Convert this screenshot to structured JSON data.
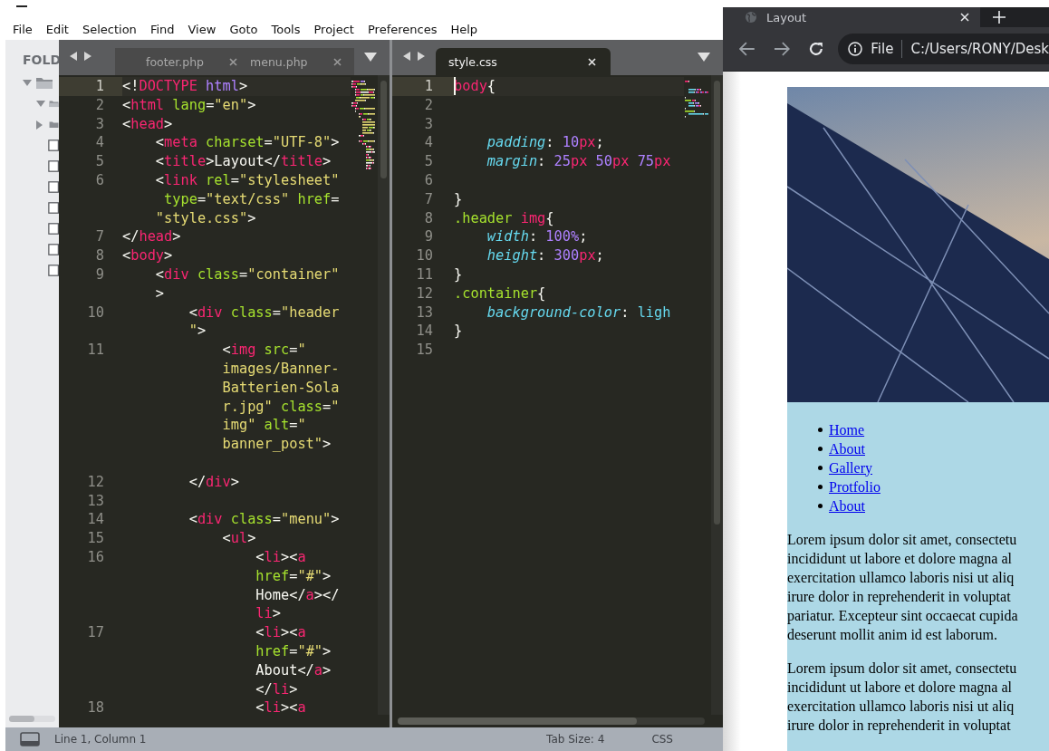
{
  "menu": [
    "File",
    "Edit",
    "Selection",
    "Find",
    "View",
    "Goto",
    "Tools",
    "Project",
    "Preferences",
    "Help"
  ],
  "sidebar": {
    "title": "FOLD",
    "items": [
      {
        "kind": "folder",
        "expanded": true,
        "children": [
          {
            "kind": "folder",
            "expanded": true
          },
          {
            "kind": "folder",
            "expanded": false
          },
          {
            "kind": "file"
          },
          {
            "kind": "file"
          },
          {
            "kind": "file"
          },
          {
            "kind": "file"
          },
          {
            "kind": "file"
          },
          {
            "kind": "file"
          },
          {
            "kind": "file"
          }
        ]
      }
    ]
  },
  "panes": [
    {
      "focused": false,
      "tabs": [
        {
          "label": "footer.php",
          "selected": false
        },
        {
          "label": "menu.php",
          "selected": false
        }
      ],
      "lines": [
        {
          "number": "1",
          "current": true,
          "rows": [
            {
              "segments": [
                {
                  "kind": "p",
                  "text": "<!"
                },
                {
                  "kind": "tag",
                  "text": "DOCTYPE"
                },
                {
                  "kind": "kw",
                  "text": " html"
                },
                {
                  "kind": "p",
                  "text": ">"
                }
              ]
            }
          ]
        },
        {
          "number": "2",
          "current": false,
          "rows": [
            {
              "segments": [
                {
                  "kind": "p",
                  "text": "<"
                },
                {
                  "kind": "tag",
                  "text": "html"
                },
                {
                  "kind": "attr",
                  "text": " lang"
                },
                {
                  "kind": "p",
                  "text": "="
                },
                {
                  "kind": "str",
                  "text": "\"en\""
                },
                {
                  "kind": "p",
                  "text": ">"
                }
              ]
            }
          ]
        },
        {
          "number": "3",
          "current": false,
          "rows": [
            {
              "segments": [
                {
                  "kind": "p",
                  "text": "<"
                },
                {
                  "kind": "tag",
                  "text": "head"
                },
                {
                  "kind": "p",
                  "text": ">"
                }
              ]
            }
          ]
        },
        {
          "number": "4",
          "current": false,
          "rows": [
            {
              "segments": [
                {
                  "kind": "p",
                  "text": "    <"
                },
                {
                  "kind": "tag",
                  "text": "meta"
                },
                {
                  "kind": "attr",
                  "text": " charset"
                },
                {
                  "kind": "p",
                  "text": "="
                },
                {
                  "kind": "str",
                  "text": "\"UTF-8\""
                },
                {
                  "kind": "p",
                  "text": ">"
                }
              ]
            }
          ]
        },
        {
          "number": "5",
          "current": false,
          "rows": [
            {
              "segments": [
                {
                  "kind": "p",
                  "text": "    <"
                },
                {
                  "kind": "tag",
                  "text": "title"
                },
                {
                  "kind": "p",
                  "text": ">Layout</"
                },
                {
                  "kind": "tag",
                  "text": "title"
                },
                {
                  "kind": "p",
                  "text": ">"
                }
              ]
            }
          ]
        },
        {
          "number": "6",
          "current": false,
          "rows": [
            {
              "segments": [
                {
                  "kind": "p",
                  "text": "    <"
                },
                {
                  "kind": "tag",
                  "text": "link"
                },
                {
                  "kind": "attr",
                  "text": " rel"
                },
                {
                  "kind": "p",
                  "text": "="
                },
                {
                  "kind": "str",
                  "text": "\"stylesheet\""
                }
              ]
            },
            {
              "segments": [
                {
                  "kind": "attr",
                  "text": "     type"
                },
                {
                  "kind": "p",
                  "text": "="
                },
                {
                  "kind": "str",
                  "text": "\"text/css\""
                },
                {
                  "kind": "attr",
                  "text": " href"
                },
                {
                  "kind": "p",
                  "text": "="
                }
              ]
            },
            {
              "segments": [
                {
                  "kind": "str",
                  "text": "    \"style.css\""
                },
                {
                  "kind": "p",
                  "text": ">"
                }
              ]
            }
          ]
        },
        {
          "number": "7",
          "current": false,
          "rows": [
            {
              "segments": [
                {
                  "kind": "p",
                  "text": "</"
                },
                {
                  "kind": "tag",
                  "text": "head"
                },
                {
                  "kind": "p",
                  "text": ">"
                }
              ]
            }
          ]
        },
        {
          "number": "8",
          "current": false,
          "rows": [
            {
              "segments": [
                {
                  "kind": "p",
                  "text": "<"
                },
                {
                  "kind": "tag",
                  "text": "body"
                },
                {
                  "kind": "p",
                  "text": ">"
                }
              ]
            }
          ]
        },
        {
          "number": "9",
          "current": false,
          "rows": [
            {
              "segments": [
                {
                  "kind": "p",
                  "text": "    <"
                },
                {
                  "kind": "tag",
                  "text": "div"
                },
                {
                  "kind": "attr",
                  "text": " class"
                },
                {
                  "kind": "p",
                  "text": "="
                },
                {
                  "kind": "str",
                  "text": "\"container\""
                }
              ]
            },
            {
              "segments": [
                {
                  "kind": "p",
                  "text": "    >"
                }
              ]
            }
          ]
        },
        {
          "number": "10",
          "current": false,
          "rows": [
            {
              "segments": [
                {
                  "kind": "p",
                  "text": "        <"
                },
                {
                  "kind": "tag",
                  "text": "div"
                },
                {
                  "kind": "attr",
                  "text": " class"
                },
                {
                  "kind": "p",
                  "text": "="
                },
                {
                  "kind": "str",
                  "text": "\"header"
                }
              ]
            },
            {
              "segments": [
                {
                  "kind": "str",
                  "text": "        \""
                },
                {
                  "kind": "p",
                  "text": ">"
                }
              ]
            }
          ]
        },
        {
          "number": "11",
          "current": false,
          "blank_after": true,
          "rows": [
            {
              "segments": [
                {
                  "kind": "p",
                  "text": "            <"
                },
                {
                  "kind": "tag",
                  "text": "img"
                },
                {
                  "kind": "attr",
                  "text": " src"
                },
                {
                  "kind": "p",
                  "text": "="
                },
                {
                  "kind": "str",
                  "text": "\""
                }
              ]
            },
            {
              "segments": [
                {
                  "kind": "str",
                  "text": "            images/Banner-"
                }
              ]
            },
            {
              "segments": [
                {
                  "kind": "str",
                  "text": "            Batterien-Sola"
                }
              ]
            },
            {
              "segments": [
                {
                  "kind": "str",
                  "text": "            r.jpg\""
                },
                {
                  "kind": "attr",
                  "text": " class"
                },
                {
                  "kind": "p",
                  "text": "="
                },
                {
                  "kind": "str",
                  "text": "\""
                }
              ]
            },
            {
              "segments": [
                {
                  "kind": "str",
                  "text": "            img\""
                },
                {
                  "kind": "attr",
                  "text": " alt"
                },
                {
                  "kind": "p",
                  "text": "="
                },
                {
                  "kind": "str",
                  "text": "\""
                }
              ]
            },
            {
              "segments": [
                {
                  "kind": "str",
                  "text": "            banner_post\""
                },
                {
                  "kind": "p",
                  "text": ">"
                }
              ]
            }
          ]
        },
        {
          "number": "12",
          "current": false,
          "rows": [
            {
              "segments": [
                {
                  "kind": "p",
                  "text": "        </"
                },
                {
                  "kind": "tag",
                  "text": "div"
                },
                {
                  "kind": "p",
                  "text": ">"
                }
              ]
            }
          ]
        },
        {
          "number": "13",
          "current": false
        },
        {
          "number": "14",
          "current": false,
          "rows": [
            {
              "segments": [
                {
                  "kind": "p",
                  "text": "        <"
                },
                {
                  "kind": "tag",
                  "text": "div"
                },
                {
                  "kind": "attr",
                  "text": " class"
                },
                {
                  "kind": "p",
                  "text": "="
                },
                {
                  "kind": "str",
                  "text": "\"menu\""
                },
                {
                  "kind": "p",
                  "text": ">"
                }
              ]
            }
          ]
        },
        {
          "number": "15",
          "current": false,
          "rows": [
            {
              "segments": [
                {
                  "kind": "p",
                  "text": "            <"
                },
                {
                  "kind": "tag",
                  "text": "ul"
                },
                {
                  "kind": "p",
                  "text": ">"
                }
              ]
            }
          ]
        },
        {
          "number": "16",
          "current": false,
          "rows": [
            {
              "segments": [
                {
                  "kind": "p",
                  "text": "                <"
                },
                {
                  "kind": "tag",
                  "text": "li"
                },
                {
                  "kind": "p",
                  "text": "><"
                },
                {
                  "kind": "tag",
                  "text": "a"
                }
              ]
            },
            {
              "segments": [
                {
                  "kind": "attr",
                  "text": "                href"
                },
                {
                  "kind": "p",
                  "text": "="
                },
                {
                  "kind": "str",
                  "text": "\"#\""
                },
                {
                  "kind": "p",
                  "text": ">"
                }
              ]
            },
            {
              "segments": [
                {
                  "kind": "p",
                  "text": "                Home</"
                },
                {
                  "kind": "tag",
                  "text": "a"
                },
                {
                  "kind": "p",
                  "text": "></"
                }
              ]
            },
            {
              "segments": [
                {
                  "kind": "tag",
                  "text": "                li"
                },
                {
                  "kind": "p",
                  "text": ">"
                }
              ]
            }
          ]
        },
        {
          "number": "17",
          "current": false,
          "rows": [
            {
              "segments": [
                {
                  "kind": "p",
                  "text": "                <"
                },
                {
                  "kind": "tag",
                  "text": "li"
                },
                {
                  "kind": "p",
                  "text": "><"
                },
                {
                  "kind": "tag",
                  "text": "a"
                }
              ]
            },
            {
              "segments": [
                {
                  "kind": "attr",
                  "text": "                href"
                },
                {
                  "kind": "p",
                  "text": "="
                },
                {
                  "kind": "str",
                  "text": "\"#\""
                },
                {
                  "kind": "p",
                  "text": ">"
                }
              ]
            },
            {
              "segments": [
                {
                  "kind": "p",
                  "text": "                About</"
                },
                {
                  "kind": "tag",
                  "text": "a"
                },
                {
                  "kind": "p",
                  "text": ">"
                }
              ]
            },
            {
              "segments": [
                {
                  "kind": "p",
                  "text": "                </"
                },
                {
                  "kind": "tag",
                  "text": "li"
                },
                {
                  "kind": "p",
                  "text": ">"
                }
              ]
            }
          ]
        },
        {
          "number": "18",
          "current": false,
          "rows": [
            {
              "segments": [
                {
                  "kind": "p",
                  "text": "                <"
                },
                {
                  "kind": "tag",
                  "text": "li"
                },
                {
                  "kind": "p",
                  "text": "><"
                },
                {
                  "kind": "tag",
                  "text": "a"
                }
              ]
            }
          ]
        }
      ]
    },
    {
      "focused": true,
      "tabs": [
        {
          "label": "style.css",
          "selected": true
        }
      ],
      "lines": [
        {
          "number": "1",
          "current": true,
          "rows": [
            {
              "segments": [
                {
                  "kind": "tag",
                  "text": "body"
                },
                {
                  "kind": "p",
                  "text": "{"
                }
              ]
            }
          ]
        },
        {
          "number": "2",
          "current": false
        },
        {
          "number": "3",
          "current": false
        },
        {
          "number": "4",
          "current": false,
          "rows": [
            {
              "segments": [
                {
                  "kind": "prop",
                  "text": "    padding"
                },
                {
                  "kind": "p",
                  "text": ": "
                },
                {
                  "kind": "num",
                  "text": "10"
                },
                {
                  "kind": "unit",
                  "text": "px"
                },
                {
                  "kind": "p",
                  "text": ";"
                }
              ]
            }
          ]
        },
        {
          "number": "5",
          "current": false,
          "rows": [
            {
              "segments": [
                {
                  "kind": "prop",
                  "text": "    margin"
                },
                {
                  "kind": "p",
                  "text": ": "
                },
                {
                  "kind": "num",
                  "text": "25"
                },
                {
                  "kind": "unit",
                  "text": "px"
                },
                {
                  "kind": "num",
                  "text": " 50"
                },
                {
                  "kind": "unit",
                  "text": "px"
                },
                {
                  "kind": "num",
                  "text": " 75"
                },
                {
                  "kind": "unit",
                  "text": "px"
                }
              ]
            }
          ]
        },
        {
          "number": "6",
          "current": false
        },
        {
          "number": "7",
          "current": false,
          "rows": [
            {
              "segments": [
                {
                  "kind": "p",
                  "text": "}"
                }
              ]
            }
          ]
        },
        {
          "number": "8",
          "current": false,
          "rows": [
            {
              "segments": [
                {
                  "kind": "cls",
                  "text": ".header"
                },
                {
                  "kind": "tag",
                  "text": " img"
                },
                {
                  "kind": "p",
                  "text": "{"
                }
              ]
            }
          ]
        },
        {
          "number": "9",
          "current": false,
          "rows": [
            {
              "segments": [
                {
                  "kind": "prop",
                  "text": "    width"
                },
                {
                  "kind": "p",
                  "text": ": "
                },
                {
                  "kind": "num",
                  "text": "100%"
                },
                {
                  "kind": "p",
                  "text": ";"
                }
              ]
            }
          ]
        },
        {
          "number": "10",
          "current": false,
          "rows": [
            {
              "segments": [
                {
                  "kind": "prop",
                  "text": "    height"
                },
                {
                  "kind": "p",
                  "text": ": "
                },
                {
                  "kind": "num",
                  "text": "300"
                },
                {
                  "kind": "unit",
                  "text": "px"
                },
                {
                  "kind": "p",
                  "text": ";"
                }
              ]
            }
          ]
        },
        {
          "number": "11",
          "current": false,
          "rows": [
            {
              "segments": [
                {
                  "kind": "p",
                  "text": "}"
                }
              ]
            }
          ]
        },
        {
          "number": "12",
          "current": false,
          "rows": [
            {
              "segments": [
                {
                  "kind": "cls",
                  "text": ".container"
                },
                {
                  "kind": "p",
                  "text": "{"
                }
              ]
            }
          ]
        },
        {
          "number": "13",
          "current": false,
          "rows": [
            {
              "segments": [
                {
                  "kind": "prop",
                  "text": "    background-color"
                },
                {
                  "kind": "p",
                  "text": ": "
                },
                {
                  "kind": "val",
                  "text": "ligh"
                }
              ]
            }
          ]
        },
        {
          "number": "14",
          "current": false,
          "rows": [
            {
              "segments": [
                {
                  "kind": "p",
                  "text": "}"
                }
              ]
            }
          ]
        },
        {
          "number": "15",
          "current": false
        }
      ]
    }
  ],
  "status_bar": {
    "position": "Line 1, Column 1",
    "tab_size": "Tab Size: 4",
    "syntax": "CSS"
  },
  "browser": {
    "tab": {
      "title": "Layout"
    },
    "address": {
      "scheme": "File",
      "url": "C:/Users/RONY/Desk"
    },
    "nav": [
      {
        "label": "Home"
      },
      {
        "label": "About"
      },
      {
        "label": "Gallery"
      },
      {
        "label": "Protfolio"
      },
      {
        "label": "About"
      }
    ],
    "paragraphs": [
      {
        "lines": [
          "Lorem ipsum dolor sit amet, consectetu",
          "incididunt ut labore et dolore magna al",
          "exercitation ullamco laboris nisi ut aliq",
          "irure dolor in reprehenderit in voluptat",
          "pariatur. Excepteur sint occaecat cupida",
          "deserunt mollit anim id est laborum."
        ]
      },
      {
        "lines": [
          "Lorem ipsum dolor sit amet, consectetu",
          "incididunt ut labore et dolore magna al",
          "exercitation ullamco laboris nisi ut aliq",
          "irure dolor in reprehenderit in voluptat"
        ]
      }
    ]
  }
}
